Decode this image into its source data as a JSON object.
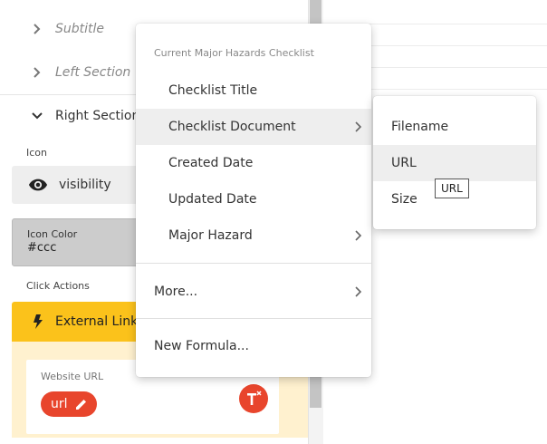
{
  "left_panel": {
    "sections": [
      {
        "label": "Subtitle",
        "state": "collapsed"
      },
      {
        "label": "Left Section",
        "state": "collapsed"
      },
      {
        "label": "Right Section",
        "state": "expanded"
      }
    ],
    "icon": {
      "label": "Icon",
      "icon_name": "eye-icon",
      "value": "visibility"
    },
    "icon_color": {
      "label": "Icon Color",
      "value": "#ccc"
    },
    "click_actions": {
      "label": "Click Actions",
      "action_title": "External Link",
      "website_url_label": "Website URL",
      "url_chip": "url"
    }
  },
  "context_menu": {
    "heading": "Current Major Hazards Checklist",
    "items": [
      {
        "label": "Checklist Title",
        "has_submenu": false
      },
      {
        "label": "Checklist Document",
        "has_submenu": true,
        "active": true
      },
      {
        "label": "Created Date",
        "has_submenu": false
      },
      {
        "label": "Updated Date",
        "has_submenu": false
      },
      {
        "label": "Major Hazard",
        "has_submenu": true
      }
    ],
    "more": "More...",
    "new_formula": "New Formula..."
  },
  "submenu": {
    "items": [
      {
        "label": "Filename"
      },
      {
        "label": "URL",
        "active": true
      },
      {
        "label": "Size"
      }
    ]
  },
  "tooltip": "URL",
  "colors": {
    "accent_yellow": "#fbc21b",
    "chip_red": "#e8452c",
    "action_body": "#fff1cf"
  }
}
